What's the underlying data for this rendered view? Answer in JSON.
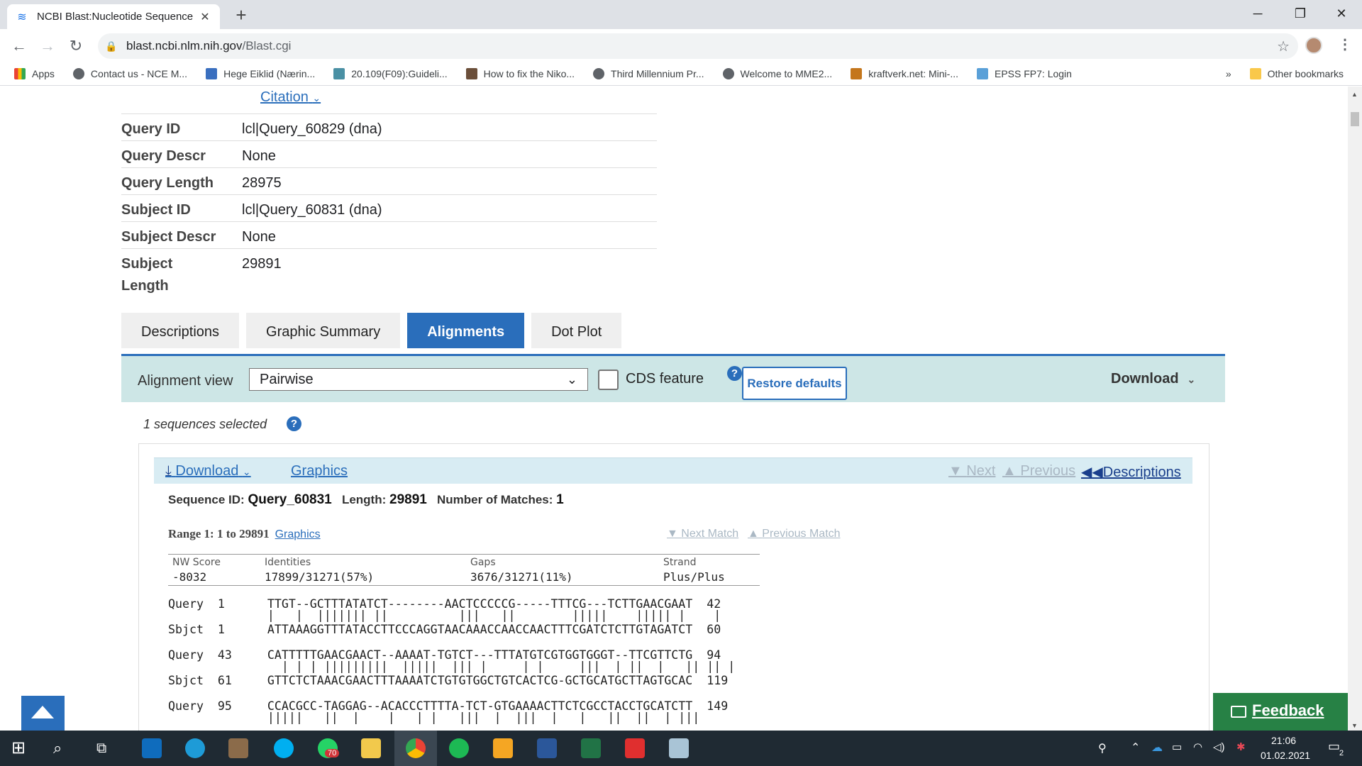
{
  "browser": {
    "tab_title": "NCBI Blast:Nucleotide Sequence",
    "tab_close": "✕",
    "new_tab": "+",
    "url_host": "blast.ncbi.nlm.nih.gov",
    "url_path": "/Blast.cgi",
    "window_controls": {
      "minimize": "─",
      "restore": "❐",
      "close": "✕"
    }
  },
  "bookmarks": [
    {
      "label": "Apps",
      "icon": "apps-grid-icon"
    },
    {
      "label": "Contact us - NCE M...",
      "icon": "globe-icon"
    },
    {
      "label": "Hege Eiklid (Nærin...",
      "icon": "site-icon"
    },
    {
      "label": "20.109(F09):Guideli...",
      "icon": "site-icon"
    },
    {
      "label": "How to fix the Niko...",
      "icon": "site-icon"
    },
    {
      "label": "Third Millennium Pr...",
      "icon": "globe-icon"
    },
    {
      "label": "Welcome to MME2...",
      "icon": "globe-icon"
    },
    {
      "label": "kraftverk.net: Mini-...",
      "icon": "site-icon"
    },
    {
      "label": "EPSS FP7: Login",
      "icon": "site-icon"
    }
  ],
  "bookmarks_overflow": "»",
  "other_bookmarks": "Other bookmarks",
  "citation": "Citation",
  "info": [
    {
      "key": "Query ID",
      "value": "lcl|Query_60829 (dna)"
    },
    {
      "key": "Query Descr",
      "value": "None"
    },
    {
      "key": "Query Length",
      "value": "28975"
    },
    {
      "key": "Subject ID",
      "value": "lcl|Query_60831 (dna)"
    },
    {
      "key": "Subject Descr",
      "value": "None"
    },
    {
      "key": "Subject Length",
      "value": "29891"
    }
  ],
  "page_tabs": [
    "Descriptions",
    "Graphic Summary",
    "Alignments",
    "Dot Plot"
  ],
  "active_tab": "Alignments",
  "toolbar": {
    "alignment_view_label": "Alignment view",
    "alignment_view_value": "Pairwise",
    "cds_label": "CDS feature",
    "cds_checked": false,
    "restore_label": "Restore defaults",
    "download_label": "Download",
    "help": "?"
  },
  "selected_count": "1 sequences selected",
  "result": {
    "download": "Download",
    "graphics": "Graphics",
    "next": "Next",
    "previous": "Previous",
    "descriptions": "Descriptions",
    "seq_id_label": "Sequence ID:",
    "seq_id": "Query_60831",
    "length_label": "Length:",
    "length": "29891",
    "matches_label": "Number of Matches:",
    "matches": "1",
    "range_label": "Range 1: 1 to 29891",
    "range_graphics": "Graphics",
    "next_match": "Next Match",
    "previous_match": "Previous Match",
    "score_headers": [
      "NW Score",
      "Identities",
      "Gaps",
      "Strand"
    ],
    "score_values": [
      "-8032",
      "17899/31271(57%)",
      "3676/31271(11%)",
      "Plus/Plus"
    ]
  },
  "alignment_lines": [
    "Query  1      TTGT--GCTTTATATCT--------AACTCCCCCG-----TTTCG---TCTTGAACGAAT  42",
    "              |   |  ||||||| ||          |||   ||        |||||    ||||| |    |",
    "Sbjct  1      ATTAAAGGTTTATACCTTCCCAGGTAACAAACCAACCAACTTTCGATCTCTTGTAGATCT  60",
    "Query  43     CATTTTTGAACGAACT--AAAAT-TGTCT---TTTATGTCGTGGTGGGT--TTCGTTCTG  94",
    "                | | | |||||||||  |||||  ||| |     | |     |||  | ||  |   || || |",
    "Sbjct  61     GTTCTCTAAACGAACTTTAAAATCTGTGTGGCTGTCACTCG-GCTGCATGCTTAGTGCAC  119",
    "Query  95     CCACGCC-TAGGAG--ACACCCTTTTA-TCT-GTGAAAACTTCTCGCCTACCTGCATCTT  149",
    "              |||||   ||  |    |   | |   |||  |  |||  |   |   ||  ||  | |||"
  ],
  "feedback": "Feedback",
  "clock": {
    "time": "21:06",
    "date": "01.02.2021"
  },
  "notifications": "2",
  "whatsapp_badge": "70"
}
